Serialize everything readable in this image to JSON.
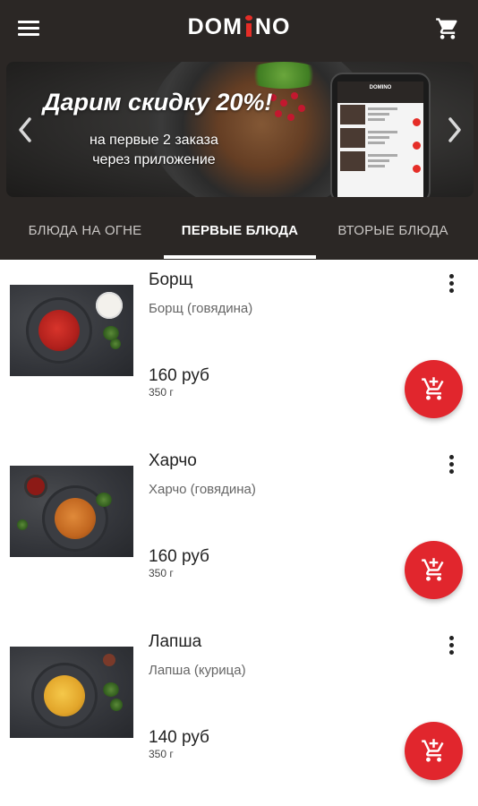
{
  "app": {
    "brand": "DOMINO",
    "brand_left": "DOM",
    "brand_right": "NO"
  },
  "banner": {
    "headline": "Дарим скидку 20%!",
    "sub_line1": "на первые 2 заказа",
    "sub_line2": "через приложение",
    "phone_brand": "DOMINO"
  },
  "tabs": [
    {
      "label": "БЛЮДА НА ОГНЕ"
    },
    {
      "label": "ПЕРВЫЕ БЛЮДА"
    },
    {
      "label": "ВТОРЫЕ БЛЮДА"
    }
  ],
  "active_tab": "ПЕРВЫЕ БЛЮДА",
  "products": [
    {
      "title": "Борщ",
      "desc": "Борщ (говядина)",
      "price": "160 руб",
      "weight": "350 г"
    },
    {
      "title": "Харчо",
      "desc": "Харчо (говядина)",
      "price": "160 руб",
      "weight": "350 г"
    },
    {
      "title": "Лапша",
      "desc": "Лапша (курица)",
      "price": "140 руб",
      "weight": "350 г"
    }
  ],
  "colors": {
    "header_bg": "#2b2725",
    "accent": "#e1262d",
    "logo_i": "#e52d27"
  },
  "icons": {
    "menu": "menu-icon",
    "cart": "cart-icon",
    "add_to_cart": "add-shopping-cart-icon",
    "more": "more-vert-icon",
    "prev": "chevron-left-icon",
    "next": "chevron-right-icon"
  }
}
